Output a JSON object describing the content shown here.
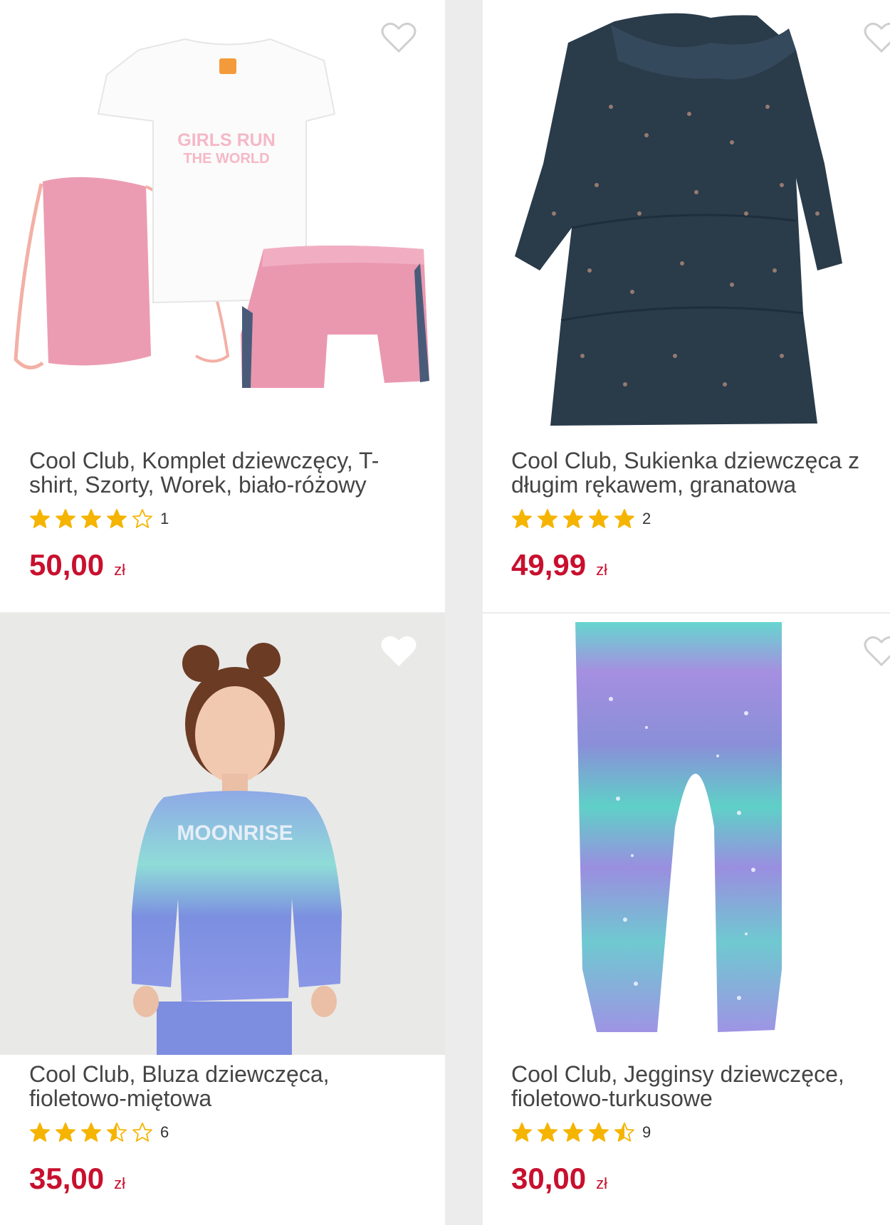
{
  "accent_color": "#c8102e",
  "star_color": "#f5b400",
  "products": [
    {
      "title": "Cool Club, Komplet dziewczęcy, T-shirt, Szorty, Worek, biało-różowy",
      "rating": 4,
      "review_count": "1",
      "price": "50,00",
      "currency": "zł",
      "image_text_line1": "GIRLS RUN",
      "image_text_line2": "THE WORLD",
      "favorite_icon": "heart-outline-icon"
    },
    {
      "title": "Cool Club, Sukienka dziewczęca z długim rękawem, granatowa",
      "rating": 5,
      "review_count": "2",
      "price": "49,99",
      "currency": "zł",
      "favorite_icon": "heart-outline-icon"
    },
    {
      "title": "Cool Club, Bluza dziewczęca, fioletowo-miętowa",
      "rating": 3.5,
      "review_count": "6",
      "price": "35,00",
      "currency": "zł",
      "image_text_line1": "MOONRISE",
      "favorite_icon": "heart-outline-icon"
    },
    {
      "title": "Cool Club, Jegginsy dziewczęce, fioletowo-turkusowe",
      "rating": 4.5,
      "review_count": "9",
      "price": "30,00",
      "currency": "zł",
      "favorite_icon": "heart-outline-icon"
    }
  ]
}
